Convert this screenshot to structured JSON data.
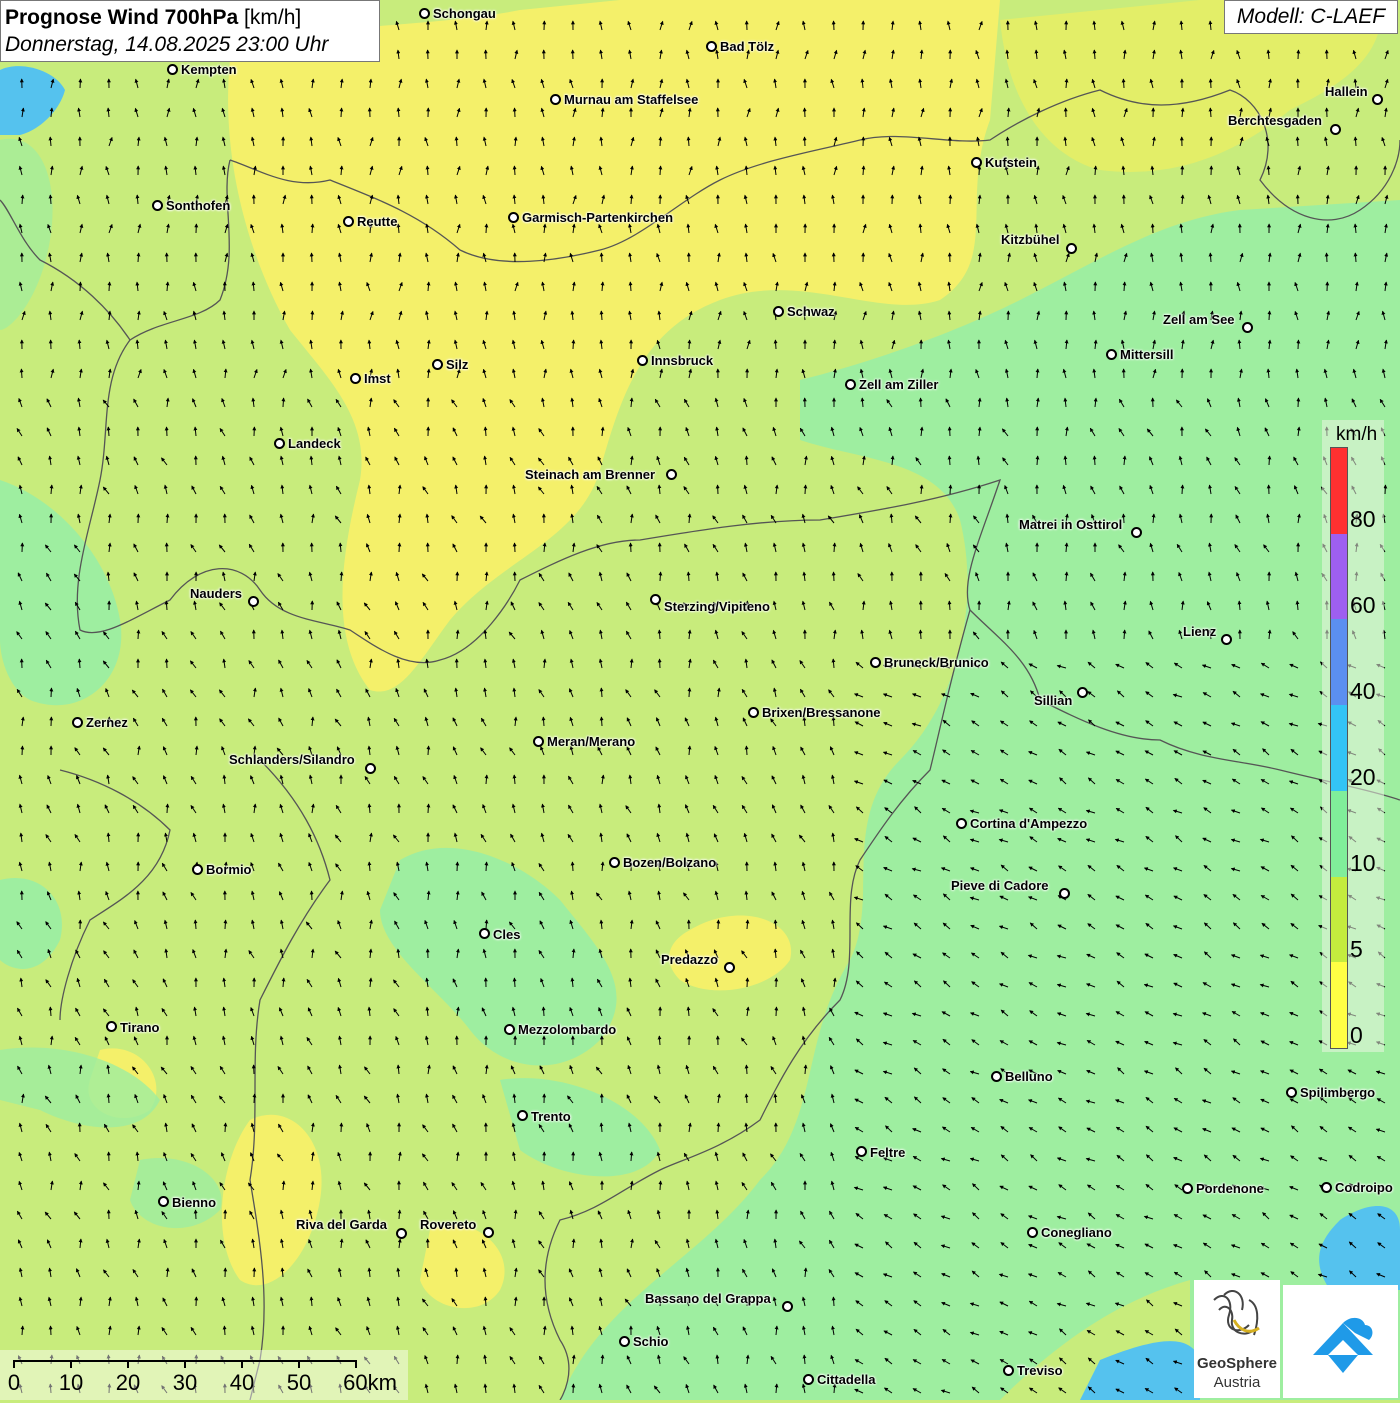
{
  "header": {
    "title_bold": "Prognose Wind 700hPa",
    "title_unit": "[km/h]",
    "datetime": "Donnerstag, 14.08.2025 23:00 Uhr",
    "model": "Modell: C-LAEF"
  },
  "cities": [
    {
      "name": "Schongau"
    },
    {
      "name": "Bad Tölz"
    },
    {
      "name": "Kempten"
    },
    {
      "name": "Murnau am Staffelsee"
    },
    {
      "name": "Hallein"
    },
    {
      "name": "Berchtesgaden"
    },
    {
      "name": "Kufstein"
    },
    {
      "name": "Sonthofen"
    },
    {
      "name": "Reutte"
    },
    {
      "name": "Garmisch-Partenkirchen"
    },
    {
      "name": "Kitzbühel"
    },
    {
      "name": "Schwaz"
    },
    {
      "name": "Zell am See"
    },
    {
      "name": "Mittersill"
    },
    {
      "name": "Silz"
    },
    {
      "name": "Innsbruck"
    },
    {
      "name": "Imst"
    },
    {
      "name": "Zell am Ziller"
    },
    {
      "name": "Landeck"
    },
    {
      "name": "Steinach am Brenner"
    },
    {
      "name": "Matrei in Osttirol"
    },
    {
      "name": "Nauders"
    },
    {
      "name": "Sterzing/Vipiteno"
    },
    {
      "name": "Lienz"
    },
    {
      "name": "Bruneck/Brunico"
    },
    {
      "name": "Sillian"
    },
    {
      "name": "Zernez"
    },
    {
      "name": "Brixen/Bressanone"
    },
    {
      "name": "Meran/Merano"
    },
    {
      "name": "Schlanders/Silandro"
    },
    {
      "name": "Cortina d'Ampezzo"
    },
    {
      "name": "Bozen/Bolzano"
    },
    {
      "name": "Bormio"
    },
    {
      "name": "Pieve di Cadore"
    },
    {
      "name": "Cles"
    },
    {
      "name": "Predazzo"
    },
    {
      "name": "Tirano"
    },
    {
      "name": "Mezzolombardo"
    },
    {
      "name": "Belluno"
    },
    {
      "name": "Spilimbergo"
    },
    {
      "name": "Trento"
    },
    {
      "name": "Feltre"
    },
    {
      "name": "Bienno"
    },
    {
      "name": "Pordenone"
    },
    {
      "name": "Codroipo"
    },
    {
      "name": "Riva del Garda"
    },
    {
      "name": "Rovereto"
    },
    {
      "name": "Conegliano"
    },
    {
      "name": "Bassano del Grappa"
    },
    {
      "name": "Schio"
    },
    {
      "name": "Treviso"
    },
    {
      "name": "Cittadella"
    }
  ],
  "legend": {
    "unit": "km/h",
    "colors": [
      "#ff3030",
      "#9e5ff0",
      "#5b8ff0",
      "#33c4f5",
      "#80ee9a",
      "#c4ec3e",
      "#ffff44"
    ],
    "labels": [
      "80",
      "60",
      "40",
      "20",
      "10",
      "5",
      "0"
    ]
  },
  "scale": {
    "labels": [
      "0",
      "10",
      "20",
      "30",
      "40",
      "50",
      "60km"
    ]
  },
  "colors": {
    "yellow": "#f4f06a",
    "lightgreen": "#c8ec7c",
    "green": "#9eeea0",
    "lake": "#55c2ee"
  },
  "logos": {
    "geo_line1": "GeoSphere",
    "geo_line2": "Austria"
  }
}
